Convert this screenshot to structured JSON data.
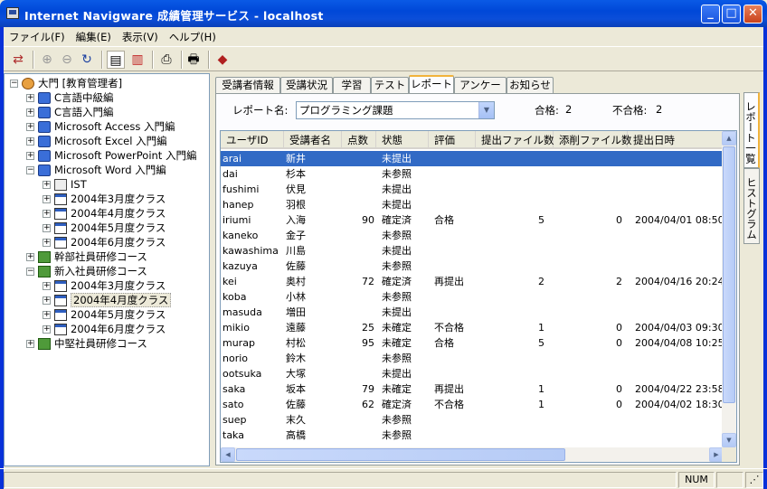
{
  "window": {
    "title": "Internet Navigware 成績管理サービス - localhost"
  },
  "menu": [
    "ファイル(F)",
    "編集(E)",
    "表示(V)",
    "ヘルプ(H)"
  ],
  "toolbar_icons": [
    "logout-icon",
    "zoom-in-icon",
    "zoom-out-icon",
    "refresh-icon",
    "view-list-icon",
    "view-graph-icon",
    "export-icon",
    "print-icon",
    "book-icon"
  ],
  "tree": [
    {
      "label": "大門 [教育管理者]",
      "level": 0,
      "icon": "root",
      "exp": "−"
    },
    {
      "label": "C言語中級編",
      "level": 1,
      "icon": "pc",
      "exp": "+"
    },
    {
      "label": "C言語入門編",
      "level": 1,
      "icon": "pc",
      "exp": "+"
    },
    {
      "label": "Microsoft Access 入門編",
      "level": 1,
      "icon": "pc",
      "exp": "+"
    },
    {
      "label": "Microsoft Excel 入門編",
      "level": 1,
      "icon": "pc",
      "exp": "+"
    },
    {
      "label": "Microsoft PowerPoint 入門編",
      "level": 1,
      "icon": "pc",
      "exp": "+"
    },
    {
      "label": "Microsoft Word 入門編",
      "level": 1,
      "icon": "pc",
      "exp": "−"
    },
    {
      "label": "IST",
      "level": 2,
      "icon": "ist",
      "exp": "+"
    },
    {
      "label": "2004年3月度クラス",
      "level": 2,
      "icon": "cls",
      "exp": "+"
    },
    {
      "label": "2004年4月度クラス",
      "level": 2,
      "icon": "cls",
      "exp": "+"
    },
    {
      "label": "2004年5月度クラス",
      "level": 2,
      "icon": "cls",
      "exp": "+"
    },
    {
      "label": "2004年6月度クラス",
      "level": 2,
      "icon": "cls",
      "exp": "+"
    },
    {
      "label": "幹部社員研修コース",
      "level": 1,
      "icon": "grp",
      "exp": "+"
    },
    {
      "label": "新入社員研修コース",
      "level": 1,
      "icon": "grp",
      "exp": "−"
    },
    {
      "label": "2004年3月度クラス",
      "level": 2,
      "icon": "cls",
      "exp": "+"
    },
    {
      "label": "2004年4月度クラス",
      "level": 2,
      "icon": "cls",
      "exp": "+",
      "selected": true
    },
    {
      "label": "2004年5月度クラス",
      "level": 2,
      "icon": "cls",
      "exp": "+"
    },
    {
      "label": "2004年6月度クラス",
      "level": 2,
      "icon": "cls",
      "exp": "+"
    },
    {
      "label": "中堅社員研修コース",
      "level": 1,
      "icon": "grp",
      "exp": "+"
    }
  ],
  "tabs": [
    "受講者情報",
    "受講状況",
    "学習",
    "テスト",
    "レポート",
    "アンケート",
    "お知らせ"
  ],
  "active_tab": "レポート",
  "report": {
    "label": "レポート名:",
    "selected": "プログラミング課題",
    "pass_label": "合格:",
    "pass_count": "2",
    "fail_label": "不合格:",
    "fail_count": "2"
  },
  "columns": [
    "ユーザID",
    "受講者名",
    "点数",
    "状態",
    "評価",
    "提出ファイル数",
    "添削ファイル数",
    "提出日時"
  ],
  "rows": [
    {
      "id": "arai",
      "name": "新井",
      "score": "",
      "status": "未提出",
      "eval": "",
      "sub": "",
      "cor": "",
      "date": "",
      "selected": true
    },
    {
      "id": "dai",
      "name": "杉本",
      "score": "",
      "status": "未参照",
      "eval": "",
      "sub": "",
      "cor": "",
      "date": ""
    },
    {
      "id": "fushimi",
      "name": "伏見",
      "score": "",
      "status": "未提出",
      "eval": "",
      "sub": "",
      "cor": "",
      "date": ""
    },
    {
      "id": "hanep",
      "name": "羽根",
      "score": "",
      "status": "未提出",
      "eval": "",
      "sub": "",
      "cor": "",
      "date": ""
    },
    {
      "id": "iriumi",
      "name": "入海",
      "score": "90",
      "status": "確定済",
      "eval": "合格",
      "sub": "5",
      "cor": "0",
      "date": "2004/04/01 08:50"
    },
    {
      "id": "kaneko",
      "name": "金子",
      "score": "",
      "status": "未参照",
      "eval": "",
      "sub": "",
      "cor": "",
      "date": ""
    },
    {
      "id": "kawashima",
      "name": "川島",
      "score": "",
      "status": "未提出",
      "eval": "",
      "sub": "",
      "cor": "",
      "date": ""
    },
    {
      "id": "kazuya",
      "name": "佐藤",
      "score": "",
      "status": "未参照",
      "eval": "",
      "sub": "",
      "cor": "",
      "date": ""
    },
    {
      "id": "kei",
      "name": "奥村",
      "score": "72",
      "status": "確定済",
      "eval": "再提出",
      "sub": "2",
      "cor": "2",
      "date": "2004/04/16 20:24"
    },
    {
      "id": "koba",
      "name": "小林",
      "score": "",
      "status": "未参照",
      "eval": "",
      "sub": "",
      "cor": "",
      "date": ""
    },
    {
      "id": "masuda",
      "name": "増田",
      "score": "",
      "status": "未提出",
      "eval": "",
      "sub": "",
      "cor": "",
      "date": ""
    },
    {
      "id": "mikio",
      "name": "遠藤",
      "score": "25",
      "status": "未確定",
      "eval": "不合格",
      "sub": "1",
      "cor": "0",
      "date": "2004/04/03 09:30"
    },
    {
      "id": "murap",
      "name": "村松",
      "score": "95",
      "status": "未確定",
      "eval": "合格",
      "sub": "5",
      "cor": "0",
      "date": "2004/04/08 10:25"
    },
    {
      "id": "norio",
      "name": "鈴木",
      "score": "",
      "status": "未参照",
      "eval": "",
      "sub": "",
      "cor": "",
      "date": ""
    },
    {
      "id": "ootsuka",
      "name": "大塚",
      "score": "",
      "status": "未提出",
      "eval": "",
      "sub": "",
      "cor": "",
      "date": ""
    },
    {
      "id": "saka",
      "name": "坂本",
      "score": "79",
      "status": "未確定",
      "eval": "再提出",
      "sub": "1",
      "cor": "0",
      "date": "2004/04/22 23:58"
    },
    {
      "id": "sato",
      "name": "佐藤",
      "score": "62",
      "status": "確定済",
      "eval": "不合格",
      "sub": "1",
      "cor": "0",
      "date": "2004/04/02 18:30"
    },
    {
      "id": "suep",
      "name": "末久",
      "score": "",
      "status": "未参照",
      "eval": "",
      "sub": "",
      "cor": "",
      "date": ""
    },
    {
      "id": "taka",
      "name": "高橋",
      "score": "",
      "status": "未参照",
      "eval": "",
      "sub": "",
      "cor": "",
      "date": ""
    }
  ],
  "side_tabs": [
    "レポート一覧",
    "ヒストグラム"
  ],
  "status_bar": {
    "num": "NUM"
  },
  "colors": {
    "title_blue": "#0a5ae6",
    "selection": "#316ac5",
    "tab_highlight": "#f1b33c"
  }
}
